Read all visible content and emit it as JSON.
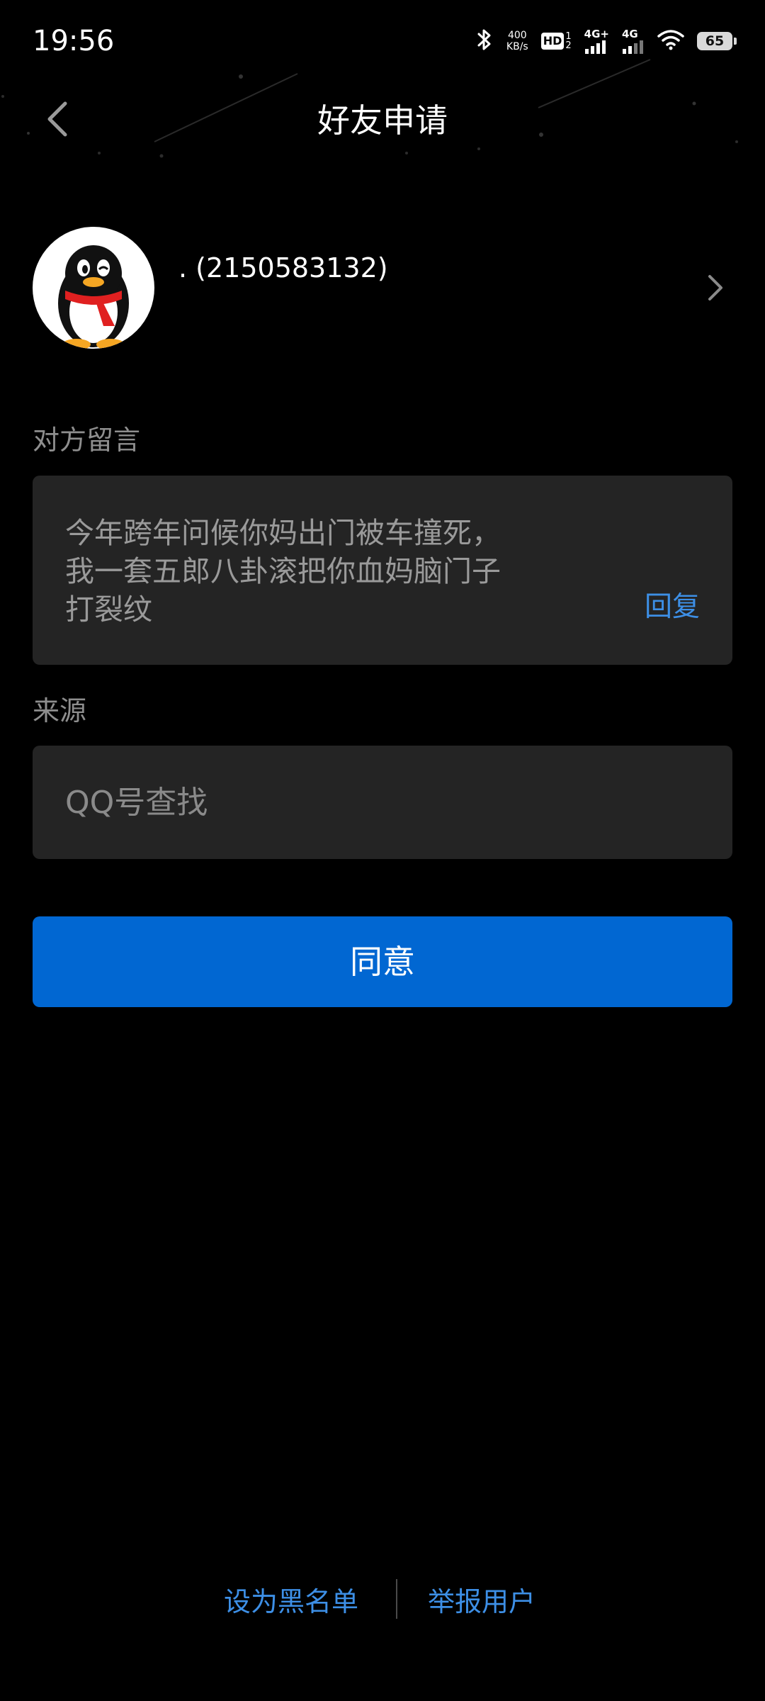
{
  "status_bar": {
    "time": "19:56",
    "net_speed_value": "400",
    "net_speed_unit": "KB/s",
    "hd_label": "HD",
    "hd_sim_1": "1",
    "hd_sim_2": "2",
    "signal_1_label": "4G+",
    "signal_2_label": "4G",
    "battery_level": "65",
    "icons": [
      "bluetooth-icon",
      "hd-icon",
      "signal-icon",
      "signal-icon",
      "wifi-icon",
      "battery-icon"
    ]
  },
  "header": {
    "title": "好友申请",
    "back_icon": "chevron-left-icon"
  },
  "profile": {
    "name": ". (2150583132)",
    "avatar_icon": "qq-penguin-icon",
    "chevron_icon": "chevron-right-icon"
  },
  "message_section": {
    "label": "对方留言",
    "text": "今年跨年问候你妈出门被车撞死，\n我一套五郎八卦滚把你血妈脑门子\n打裂纹",
    "reply_label": "回复"
  },
  "source_section": {
    "label": "来源",
    "value": "QQ号查找"
  },
  "agree_button": {
    "label": "同意"
  },
  "footer": {
    "blacklist_label": "设为黑名单",
    "report_label": "举报用户"
  },
  "colors": {
    "background": "#000000",
    "card": "#242424",
    "primary_button": "#0167d2",
    "link": "#3d8fe6",
    "secondary_text": "#8e8e8e"
  }
}
